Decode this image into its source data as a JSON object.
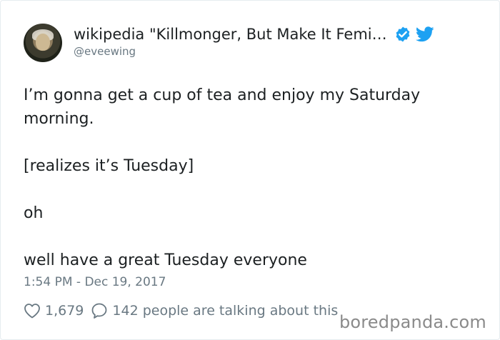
{
  "author": {
    "display_name": "wikipedia \"Killmonger, But Make It Femi…",
    "handle": "@eveewing",
    "verified": true
  },
  "tweet": {
    "paragraphs": [
      "I’m gonna get a cup of tea and enjoy my Saturday morning.",
      "[realizes it’s Tuesday]",
      "oh",
      "well have a great Tuesday everyone"
    ],
    "timestamp": "1:54 PM - Dec 19, 2017"
  },
  "actions": {
    "like_count": "1,679",
    "talking_label": "142 people are talking about this"
  },
  "watermark": "boredpanda.com",
  "colors": {
    "twitter_blue": "#1da1f2",
    "text": "#1c2022",
    "muted": "#697882"
  },
  "icons": {
    "verified": "verified-badge-icon",
    "bird": "twitter-bird-icon",
    "like": "heart-outline-icon",
    "reply": "speech-bubble-icon"
  }
}
